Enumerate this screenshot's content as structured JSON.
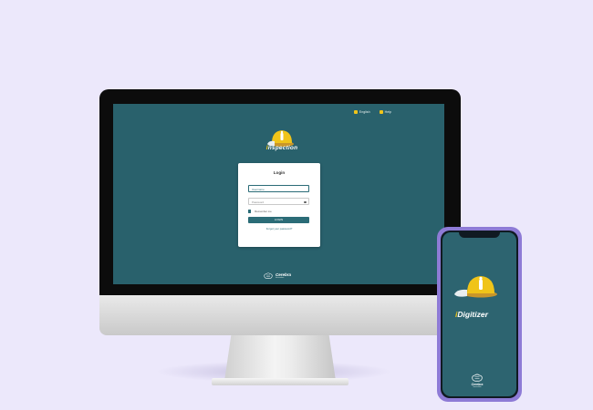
{
  "desktop": {
    "top_links": [
      {
        "icon": "globe-icon",
        "label": "English"
      },
      {
        "icon": "help-icon",
        "label": "Help"
      }
    ],
    "app_name_first": "I",
    "app_name_rest": "nspection",
    "login": {
      "title": "Login",
      "username_placeholder": "Username",
      "password_placeholder": "Password",
      "remember_label": "Remember me",
      "button_label": "LOGIN",
      "forgot_label": "Forgot your password?"
    },
    "footer_brand": "Cerebra",
    "footer_tagline": "Innovation"
  },
  "mobile": {
    "app_name_first": "i",
    "app_name_rest": "Digitizer",
    "footer_brand": "Cerebra",
    "footer_tagline": "Innovation"
  },
  "colors": {
    "background": "#ece8fb",
    "screen": "#29616c",
    "accent": "#f0c419",
    "phone_frame": "#8e7bd6"
  }
}
